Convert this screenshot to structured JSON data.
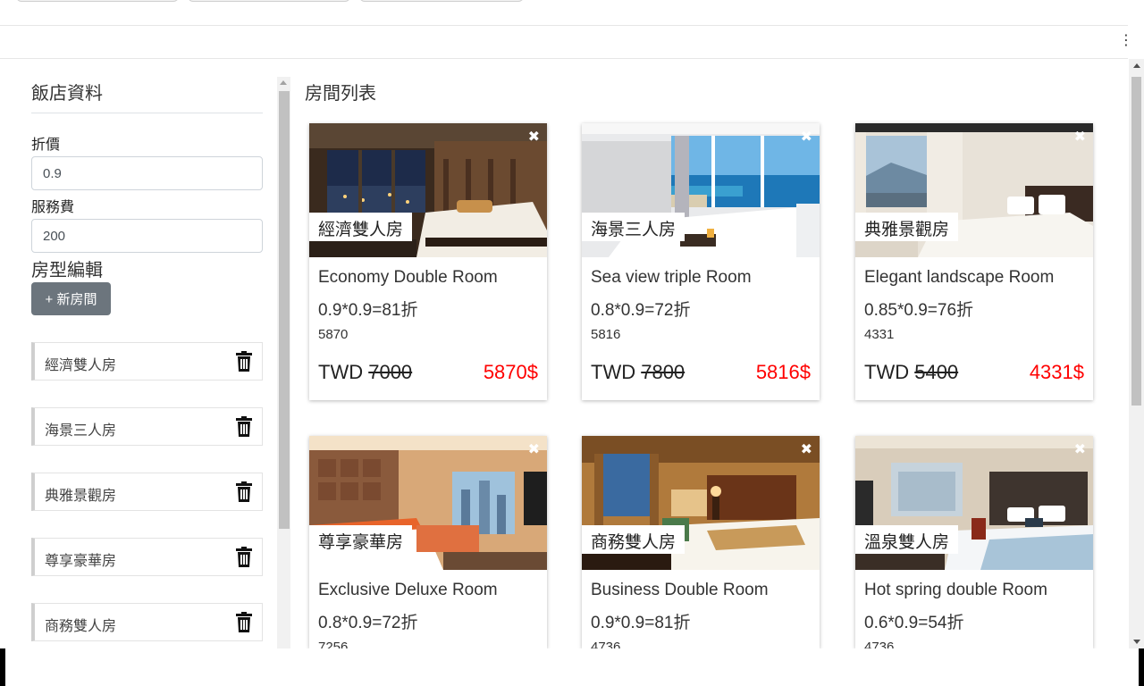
{
  "sidebar": {
    "title": "飯店資料",
    "discount_label": "折價",
    "discount_value": "0.9",
    "service_label": "服務費",
    "service_value": "200",
    "edit_title": "房型編輯",
    "new_room_button": "+ 新房間",
    "rooms": [
      {
        "name": "經濟雙人房"
      },
      {
        "name": "海景三人房"
      },
      {
        "name": "典雅景觀房"
      },
      {
        "name": "尊享豪華房"
      },
      {
        "name": "商務雙人房"
      }
    ]
  },
  "main": {
    "title": "房間列表",
    "cards": [
      {
        "tag": "經濟雙人房",
        "name_en": "Economy Double Room",
        "calc": "0.9*0.9=81折",
        "price": "5870",
        "currency": "TWD",
        "original": "7000",
        "final": "5870$",
        "theme": "night-city"
      },
      {
        "tag": "海景三人房",
        "name_en": "Sea view triple Room",
        "calc": "0.8*0.9=72折",
        "price": "5816",
        "currency": "TWD",
        "original": "7800",
        "final": "5816$",
        "theme": "sea-view"
      },
      {
        "tag": "典雅景觀房",
        "name_en": "Elegant landscape Room",
        "calc": "0.85*0.9=76折",
        "price": "4331",
        "currency": "TWD",
        "original": "5400",
        "final": "4331$",
        "theme": "bright-elegant"
      },
      {
        "tag": "尊享豪華房",
        "name_en": "Exclusive Deluxe Room",
        "calc": "0.8*0.9=72折",
        "price": "7256",
        "theme": "deluxe-orange"
      },
      {
        "tag": "商務雙人房",
        "name_en": "Business Double Room",
        "calc": "0.9*0.9=81折",
        "price": "4736",
        "theme": "business-warm"
      },
      {
        "tag": "溫泉雙人房",
        "name_en": "Hot spring double Room",
        "calc": "0.6*0.9=54折",
        "price": "4736",
        "theme": "hot-spring"
      }
    ]
  },
  "colors": {
    "final_price": "#ff0000",
    "button": "#6c757d"
  },
  "icons": {
    "close": "close-icon",
    "delete": "trash-icon"
  }
}
